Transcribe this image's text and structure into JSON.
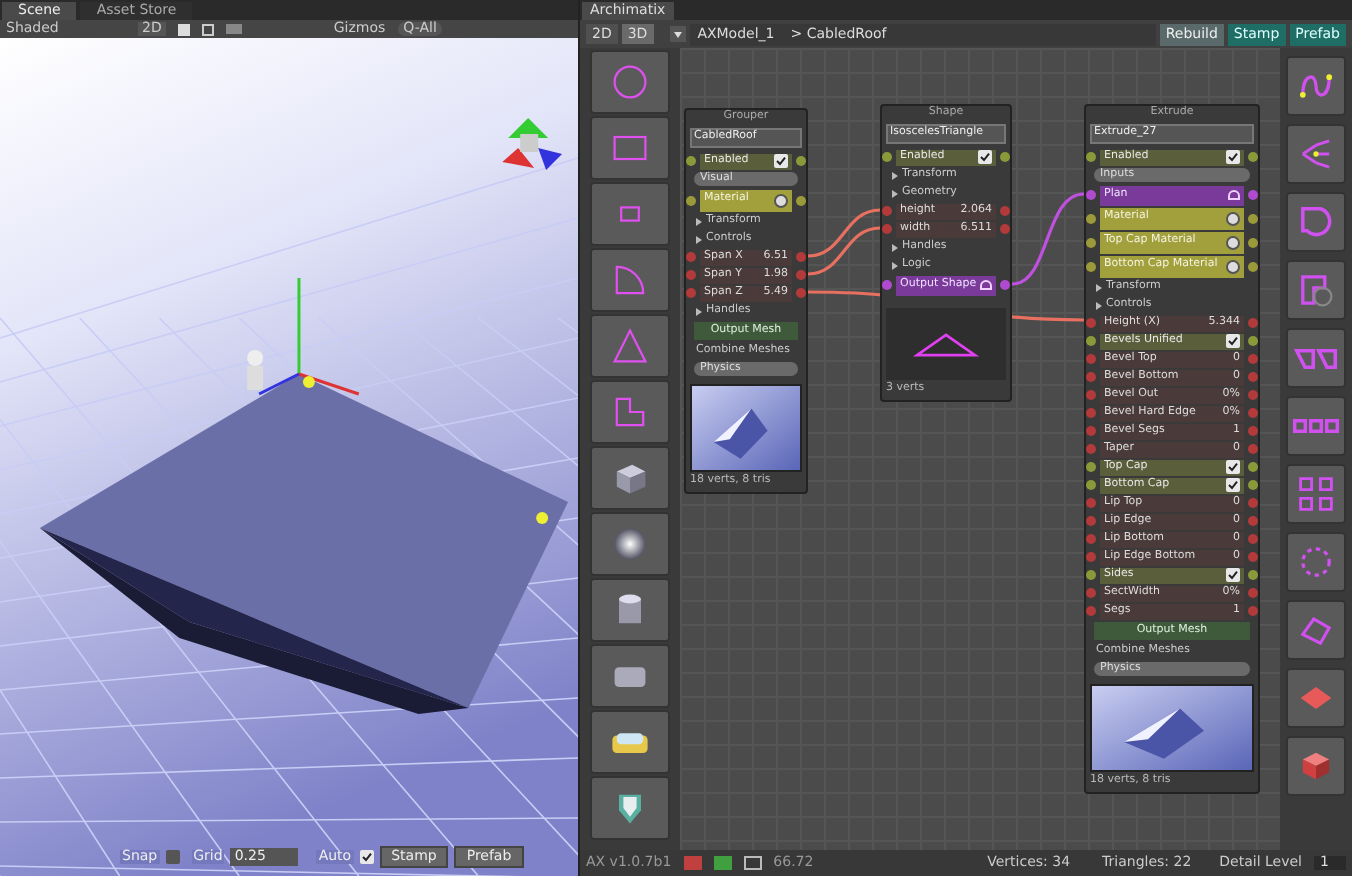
{
  "scene": {
    "tabs": [
      {
        "label": "Scene",
        "selected": true
      },
      {
        "label": "Asset Store",
        "selected": false
      }
    ],
    "toolbar": {
      "shading": "Shaded",
      "mode": "2D",
      "gizmos": "Gizmos",
      "search": "Q-All"
    },
    "bottom": {
      "snap_label": "Snap",
      "snap": false,
      "grid_label": "Grid",
      "grid": "0.25",
      "auto_label": "Auto",
      "auto": true,
      "buttons": [
        "Stamp",
        "Prefab"
      ]
    }
  },
  "archimatix": {
    "tab": "Archimatix",
    "view_modes": [
      {
        "label": "2D",
        "selected": false
      },
      {
        "label": "3D",
        "selected": true
      }
    ],
    "breadcrumb": [
      "AXModel_1",
      "> CabledRoof"
    ],
    "actions": [
      {
        "label": "Rebuild",
        "kind": "plain"
      },
      {
        "label": "Stamp",
        "kind": "accent"
      },
      {
        "label": "Prefab",
        "kind": "accent"
      }
    ],
    "nodes": [
      {
        "title": "Grouper",
        "name": "CabledRoof",
        "kind": "mesh",
        "footer": "18 verts, 8 tris",
        "rows": [
          {
            "kind": "toggle",
            "label": "Enabled",
            "checked": true
          },
          {
            "kind": "field",
            "label": "Visual"
          },
          {
            "kind": "material",
            "label": "Material"
          },
          {
            "kind": "section",
            "label": "Transform"
          },
          {
            "kind": "section",
            "label": "Controls"
          },
          {
            "kind": "param",
            "label": "Span X",
            "value": "6.51"
          },
          {
            "kind": "param",
            "label": "Span Y",
            "value": "1.98"
          },
          {
            "kind": "param",
            "label": "Span Z",
            "value": "5.49"
          },
          {
            "kind": "section",
            "label": "Handles"
          },
          {
            "kind": "output",
            "label": "Output Mesh"
          },
          {
            "kind": "text",
            "label": "Combine Meshes"
          },
          {
            "kind": "field",
            "label": "Physics"
          }
        ]
      },
      {
        "title": "Shape",
        "name": "IsoscelesTriangle",
        "kind": "shape",
        "footer": "3 verts",
        "rows": [
          {
            "kind": "toggle",
            "label": "Enabled",
            "checked": true
          },
          {
            "kind": "section",
            "label": "Transform"
          },
          {
            "kind": "section",
            "label": "Geometry"
          },
          {
            "kind": "param",
            "label": "height",
            "value": "2.064"
          },
          {
            "kind": "param",
            "label": "width",
            "value": "6.511"
          },
          {
            "kind": "section",
            "label": "Handles"
          },
          {
            "kind": "section",
            "label": "Logic"
          },
          {
            "kind": "plan",
            "label": "Output Shape"
          }
        ]
      },
      {
        "title": "Extrude",
        "name": "Extrude_27",
        "kind": "mesh",
        "footer": "18 verts, 8 tris",
        "rows": [
          {
            "kind": "toggle",
            "label": "Enabled",
            "checked": true
          },
          {
            "kind": "field",
            "label": "Inputs"
          },
          {
            "kind": "plan",
            "label": "Plan"
          },
          {
            "kind": "material",
            "label": "Material"
          },
          {
            "kind": "material",
            "label": "Top Cap Material"
          },
          {
            "kind": "material",
            "label": "Bottom Cap Material"
          },
          {
            "kind": "section",
            "label": "Transform"
          },
          {
            "kind": "section",
            "label": "Controls"
          },
          {
            "kind": "param",
            "label": "Height (X)",
            "value": "5.344"
          },
          {
            "kind": "toggle",
            "label": "Bevels Unified",
            "checked": true
          },
          {
            "kind": "param",
            "label": "Bevel Top",
            "value": "0"
          },
          {
            "kind": "param",
            "label": "Bevel Bottom",
            "value": "0"
          },
          {
            "kind": "param",
            "label": "Bevel Out",
            "value": "0%"
          },
          {
            "kind": "param",
            "label": "Bevel Hard Edge",
            "value": "0%"
          },
          {
            "kind": "param",
            "label": "Bevel Segs",
            "value": "1"
          },
          {
            "kind": "param",
            "label": "Taper",
            "value": "0"
          },
          {
            "kind": "toggle",
            "label": "Top Cap",
            "checked": true
          },
          {
            "kind": "toggle",
            "label": "Bottom Cap",
            "checked": true
          },
          {
            "kind": "param",
            "label": "Lip Top",
            "value": "0"
          },
          {
            "kind": "param",
            "label": "Lip Edge",
            "value": "0"
          },
          {
            "kind": "param",
            "label": "Lip Bottom",
            "value": "0"
          },
          {
            "kind": "param",
            "label": "Lip Edge Bottom",
            "value": "0"
          },
          {
            "kind": "toggle",
            "label": "Sides",
            "checked": true
          },
          {
            "kind": "param",
            "label": "SectWidth",
            "value": "0%"
          },
          {
            "kind": "param",
            "label": "Segs",
            "value": "1"
          },
          {
            "kind": "output",
            "label": "Output Mesh"
          },
          {
            "kind": "text",
            "label": "Combine Meshes"
          },
          {
            "kind": "field",
            "label": "Physics"
          }
        ]
      }
    ],
    "status": {
      "version": "AX v1.0.7b1",
      "fps": "66.72",
      "vertices": "Vertices: 34",
      "triangles": "Triangles: 22",
      "detail_label": "Detail Level",
      "detail": "1"
    }
  }
}
